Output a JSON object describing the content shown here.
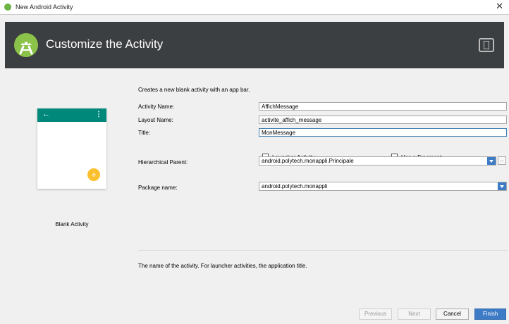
{
  "window": {
    "title": "New Android Activity",
    "close_glyph": "✕"
  },
  "banner": {
    "heading": "Customize the Activity"
  },
  "preview": {
    "back_glyph": "←",
    "more_glyph": "⋮",
    "fab_glyph": "+",
    "caption": "Blank Activity"
  },
  "form": {
    "description": "Creates a new blank activity with an app bar.",
    "activity_name": {
      "label": "Activity Name:",
      "value": "AffichMessage"
    },
    "layout_name": {
      "label": "Layout Name:",
      "value": "activite_affich_message"
    },
    "title": {
      "label": "Title:",
      "value": "MonMessage"
    },
    "launcher_activity": {
      "label": "Launcher Activity",
      "checked": false
    },
    "use_fragment": {
      "label": "Use a Fragment",
      "checked": false
    },
    "hierarchical_parent": {
      "label": "Hierarchical Parent:",
      "value": "android.polytech.monappli.Principale",
      "browse_glyph": "..."
    },
    "package_name": {
      "label": "Package name:",
      "value": "android.polytech.monappli"
    }
  },
  "help_text": "The name of the activity. For launcher activities, the application title.",
  "buttons": {
    "previous": "Previous",
    "next": "Next",
    "cancel": "Cancel",
    "finish": "Finish"
  },
  "colors": {
    "accent": "#3d7bc7",
    "banner": "#3c3f41",
    "appbar": "#00897b",
    "fab": "#fbc02d"
  }
}
